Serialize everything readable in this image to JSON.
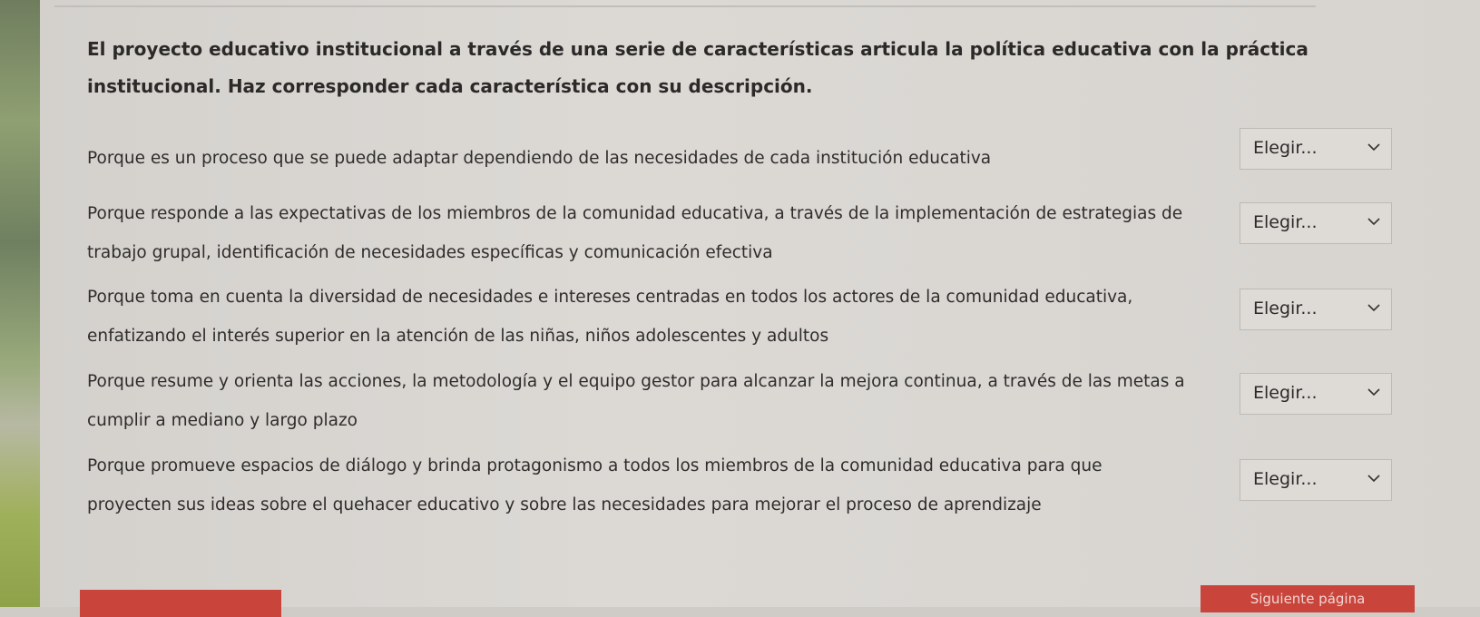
{
  "question": {
    "line1": "El proyecto educativo institucional a través de una serie de características articula la política educativa con la práctica",
    "line2": "institucional.  Haz corresponder cada característica con su descripción."
  },
  "items": [
    {
      "line1": "Porque es un proceso que se puede adaptar dependiendo de las necesidades de cada institución educativa",
      "line2": "",
      "select": "Elegir..."
    },
    {
      "line1": "Porque responde a las expectativas de los miembros de la comunidad educativa, a través de la implementación de estrategias de",
      "line2": "trabajo grupal, identificación de necesidades específicas y comunicación efectiva",
      "select": "Elegir..."
    },
    {
      "line1": "Porque toma en cuenta la diversidad de necesidades e intereses centradas en todos los actores de la comunidad educativa,",
      "line2": "enfatizando el interés superior en la atención de las niñas, niños adolescentes y adultos",
      "select": "Elegir..."
    },
    {
      "line1": "Porque resume y orienta las acciones, la metodología y el equipo gestor para alcanzar la mejora continua, a través de las metas a",
      "line2": "cumplir a mediano y largo plazo",
      "select": "Elegir..."
    },
    {
      "line1": "Porque promueve espacios de diálogo y brinda protagonismo a todos los miembros de la comunidad educativa para que",
      "line2": "proyecten sus ideas sobre el quehacer educativo y sobre las necesidades para mejorar el proceso de aprendizaje",
      "select": "Elegir..."
    }
  ],
  "buttons": {
    "next_label": "Siguiente página"
  },
  "colors": {
    "accent": "#c9453c",
    "background": "#d8d5d1"
  }
}
